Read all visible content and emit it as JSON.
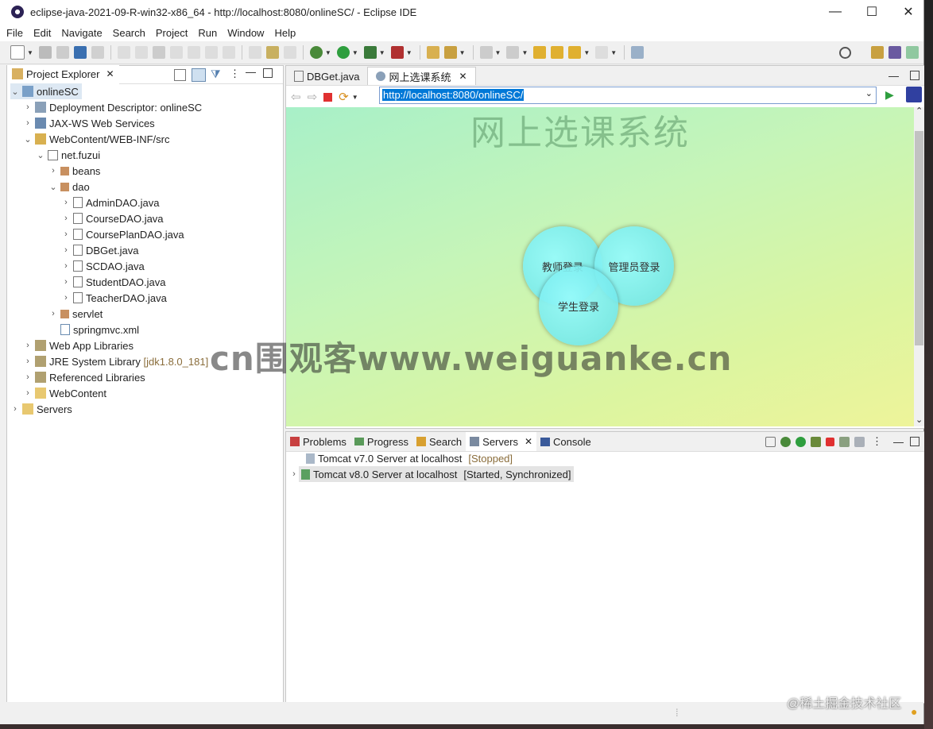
{
  "window": {
    "title": "eclipse-java-2021-09-R-win32-x86_64 - http://localhost:8080/onlineSC/ - Eclipse IDE",
    "minimize": "—",
    "maximize": "☐",
    "close": "✕"
  },
  "menu": [
    "File",
    "Edit",
    "Navigate",
    "Search",
    "Project",
    "Run",
    "Window",
    "Help"
  ],
  "project_explorer": {
    "tab_label": "Project Explorer",
    "tree": {
      "root": "onlineSC",
      "deployment": "Deployment Descriptor: onlineSC",
      "jaxws": "JAX-WS Web Services",
      "webcontent_src": "WebContent/WEB-INF/src",
      "package": "net.fuzui",
      "beans": "beans",
      "dao": "dao",
      "files": [
        "AdminDAO.java",
        "CourseDAO.java",
        "CoursePlanDAO.java",
        "DBGet.java",
        "SCDAO.java",
        "StudentDAO.java",
        "TeacherDAO.java"
      ],
      "servlet": "servlet",
      "springmvc": "springmvc.xml",
      "webapp_libs": "Web App Libraries",
      "jre": "JRE System Library",
      "jre_decor": "[jdk1.8.0_181]",
      "ref_libs": "Referenced Libraries",
      "webcontent": "WebContent",
      "servers": "Servers"
    }
  },
  "editor": {
    "tabs": [
      {
        "label": "DBGet.java"
      },
      {
        "label": "网上选课系统"
      }
    ],
    "url": "http://localhost:8080/onlineSC/",
    "page": {
      "heading": "网上选课系统",
      "buttons": {
        "teacher": "教师登录",
        "admin": "管理员登录",
        "student": "学生登录"
      }
    }
  },
  "bottom_panel": {
    "tabs": [
      "Problems",
      "Progress",
      "Search",
      "Servers",
      "Console"
    ],
    "servers": [
      {
        "name": "Tomcat v7.0 Server at localhost",
        "state": "[Stopped]"
      },
      {
        "name": "Tomcat v8.0 Server at localhost",
        "state": "[Started, Synchronized]"
      }
    ]
  },
  "overlay": {
    "watermark": "cn围观客www.weiguanke.cn",
    "juejin": "@稀土掘金技术社区"
  },
  "colors": {
    "accent": "#0078d7",
    "stop": "#e03030",
    "run": "#2e9e3e"
  }
}
